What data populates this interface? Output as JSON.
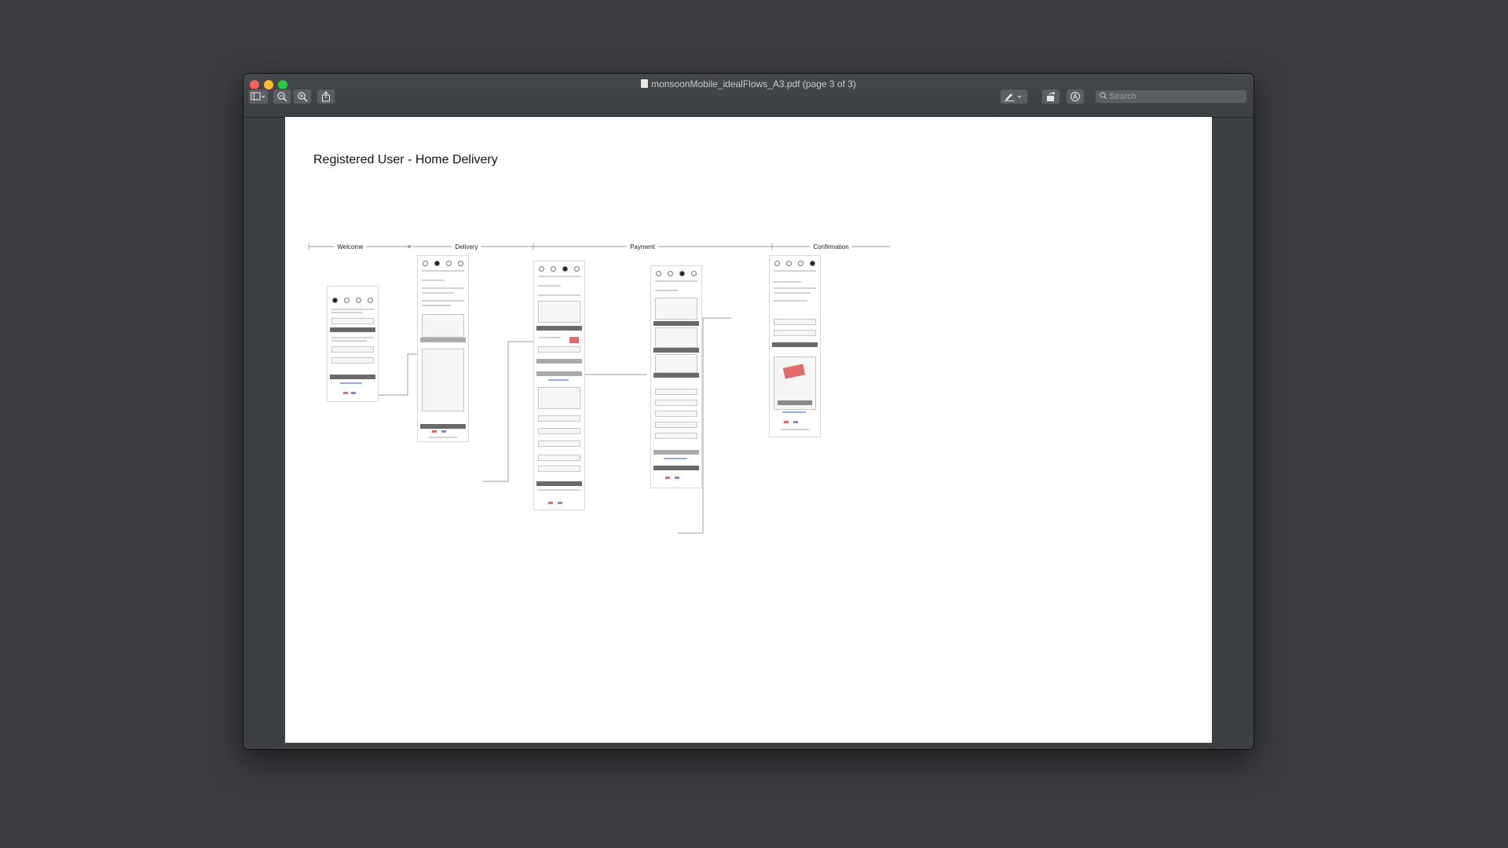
{
  "window": {
    "title": "monsoonMobile_idealFlows_A3.pdf (page 3 of 3)"
  },
  "toolbar": {
    "sidebar_icon": "sidebar-toggle-icon",
    "zoom_out_icon": "zoom-out-icon",
    "zoom_in_icon": "zoom-in-icon",
    "share_icon": "share-icon",
    "markup_icon": "pen-markup-icon",
    "rotate_icon": "rotate-icon",
    "annotate_icon": "annotate-icon",
    "search_placeholder": "Search"
  },
  "document": {
    "heading": "Registered User - Home Delivery",
    "stages": [
      "Welcome",
      "Delivery",
      "Payment",
      "Confirmation"
    ]
  },
  "colors": {
    "desktop": "#3a3c40",
    "window": "#3d4043",
    "accent_red": "#e26a6a",
    "button_dark": "#6a6a6a"
  }
}
